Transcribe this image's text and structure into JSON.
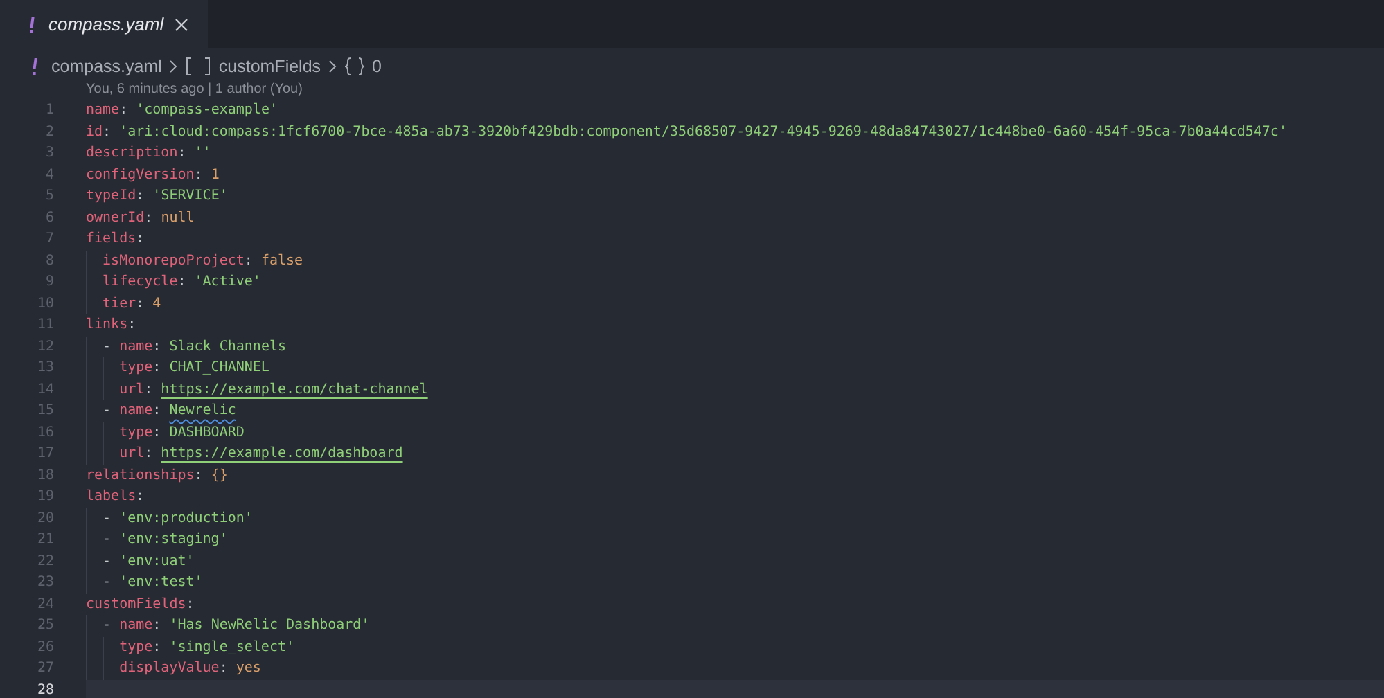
{
  "tabs": [
    {
      "label": "compass.yaml",
      "selected": true,
      "preview": true
    }
  ],
  "breadcrumbs": [
    {
      "kind": "file",
      "text": "compass.yaml"
    },
    {
      "kind": "array",
      "text": "customFields"
    },
    {
      "kind": "object",
      "text": "0"
    }
  ],
  "codelens": "You, 6 minutes ago | 1 author (You)",
  "lines": [
    {
      "number": "1",
      "tokens": [
        {
          "kind": "key",
          "text": "name"
        },
        {
          "kind": "punct",
          "text": ":"
        },
        {
          "kind": "string",
          "text": "'compass-example'"
        }
      ]
    },
    {
      "number": "2",
      "tokens": [
        {
          "kind": "key",
          "text": "id"
        },
        {
          "kind": "punct",
          "text": ":"
        },
        {
          "kind": "string",
          "text": "'ari:cloud:compass:1fcf6700-7bce-485a-ab73-3920bf429bdb:component/35d68507-9427-4945-9269-48da84743027/1c448be0-6a60-454f-95ca-7b0a44cd547c'"
        }
      ]
    },
    {
      "number": "3",
      "tokens": [
        {
          "kind": "key",
          "text": "description"
        },
        {
          "kind": "punct",
          "text": ":"
        },
        {
          "kind": "string",
          "text": "''"
        }
      ]
    },
    {
      "number": "4",
      "tokens": [
        {
          "kind": "key",
          "text": "configVersion"
        },
        {
          "kind": "punct",
          "text": ":"
        },
        {
          "kind": "number",
          "text": "1"
        }
      ]
    },
    {
      "number": "5",
      "tokens": [
        {
          "kind": "key",
          "text": "typeId"
        },
        {
          "kind": "punct",
          "text": ":"
        },
        {
          "kind": "string",
          "text": "'SERVICE'"
        }
      ]
    },
    {
      "number": "6",
      "tokens": [
        {
          "kind": "key",
          "text": "ownerId"
        },
        {
          "kind": "punct",
          "text": ":"
        },
        {
          "kind": "number",
          "text": "null"
        }
      ]
    },
    {
      "number": "7",
      "tokens": [
        {
          "kind": "key",
          "text": "fields"
        },
        {
          "kind": "punct",
          "text": ":"
        }
      ],
      "children": [
        {
          "number": "8",
          "tokens": [
            {
              "kind": "key",
              "text": "isMonorepoProject"
            },
            {
              "kind": "punct",
              "text": ":"
            },
            {
              "kind": "number",
              "text": "false"
            }
          ]
        },
        {
          "number": "9",
          "tokens": [
            {
              "kind": "key",
              "text": "lifecycle"
            },
            {
              "kind": "punct",
              "text": ":"
            },
            {
              "kind": "string",
              "text": "'Active'"
            }
          ]
        },
        {
          "number": "10",
          "tokens": [
            {
              "kind": "key",
              "text": "tier"
            },
            {
              "kind": "punct",
              "text": ":"
            },
            {
              "kind": "number",
              "text": "4"
            }
          ]
        }
      ]
    },
    {
      "number": "11",
      "tokens": [
        {
          "kind": "key",
          "text": "links"
        },
        {
          "kind": "punct",
          "text": ":"
        }
      ],
      "children": [
        {
          "number": "12",
          "tokens": [
            {
              "kind": "dash",
              "text": "-"
            },
            {
              "kind": "key",
              "text": "name"
            },
            {
              "kind": "punct",
              "text": ":"
            },
            {
              "kind": "string",
              "text": "Slack Channels"
            }
          ],
          "children": [
            {
              "number": "13",
              "tokens": [
                {
                  "kind": "key",
                  "text": "type"
                },
                {
                  "kind": "punct",
                  "text": ":"
                },
                {
                  "kind": "string",
                  "text": "CHAT_CHANNEL"
                }
              ]
            },
            {
              "number": "14",
              "tokens": [
                {
                  "kind": "key",
                  "text": "url"
                },
                {
                  "kind": "punct",
                  "text": ":"
                },
                {
                  "kind": "link",
                  "text": "https://example.com/chat-channel"
                }
              ]
            }
          ]
        },
        {
          "number": "15",
          "tokens": [
            {
              "kind": "dash",
              "text": "-"
            },
            {
              "kind": "key",
              "text": "name"
            },
            {
              "kind": "punct",
              "text": ":"
            },
            {
              "kind": "string",
              "text": "Newrelic",
              "spell_warning": true
            }
          ],
          "children": [
            {
              "number": "16",
              "tokens": [
                {
                  "kind": "key",
                  "text": "type"
                },
                {
                  "kind": "punct",
                  "text": ":"
                },
                {
                  "kind": "string",
                  "text": "DASHBOARD"
                }
              ]
            },
            {
              "number": "17",
              "tokens": [
                {
                  "kind": "key",
                  "text": "url"
                },
                {
                  "kind": "punct",
                  "text": ":"
                },
                {
                  "kind": "link",
                  "text": "https://example.com/dashboard"
                }
              ]
            }
          ]
        }
      ]
    },
    {
      "number": "18",
      "tokens": [
        {
          "kind": "key",
          "text": "relationships"
        },
        {
          "kind": "punct",
          "text": ":"
        },
        {
          "kind": "number",
          "text": "{}"
        }
      ]
    },
    {
      "number": "19",
      "tokens": [
        {
          "kind": "key",
          "text": "labels"
        },
        {
          "kind": "punct",
          "text": ":"
        }
      ],
      "children": [
        {
          "number": "20",
          "tokens": [
            {
              "kind": "dash",
              "text": "-"
            },
            {
              "kind": "string",
              "text": "'env:production'"
            }
          ]
        },
        {
          "number": "21",
          "tokens": [
            {
              "kind": "dash",
              "text": "-"
            },
            {
              "kind": "string",
              "text": "'env:staging'"
            }
          ]
        },
        {
          "number": "22",
          "tokens": [
            {
              "kind": "dash",
              "text": "-"
            },
            {
              "kind": "string",
              "text": "'env:uat'"
            }
          ]
        },
        {
          "number": "23",
          "tokens": [
            {
              "kind": "dash",
              "text": "-"
            },
            {
              "kind": "string",
              "text": "'env:test'"
            }
          ]
        }
      ]
    },
    {
      "number": "24",
      "tokens": [
        {
          "kind": "key",
          "text": "customFields"
        },
        {
          "kind": "punct",
          "text": ":"
        }
      ],
      "children": [
        {
          "number": "25",
          "tokens": [
            {
              "kind": "dash",
              "text": "-"
            },
            {
              "kind": "key",
              "text": "name"
            },
            {
              "kind": "punct",
              "text": ":"
            },
            {
              "kind": "string",
              "text": "'Has NewRelic Dashboard'"
            }
          ],
          "children": [
            {
              "number": "26",
              "tokens": [
                {
                  "kind": "key",
                  "text": "type"
                },
                {
                  "kind": "punct",
                  "text": ":"
                },
                {
                  "kind": "string",
                  "text": "'single_select'"
                }
              ]
            },
            {
              "number": "27",
              "tokens": [
                {
                  "kind": "key",
                  "text": "displayValue"
                },
                {
                  "kind": "punct",
                  "text": ":"
                },
                {
                  "kind": "number",
                  "text": "yes"
                }
              ]
            }
          ]
        }
      ]
    },
    {
      "number": "28",
      "current": true
    }
  ]
}
